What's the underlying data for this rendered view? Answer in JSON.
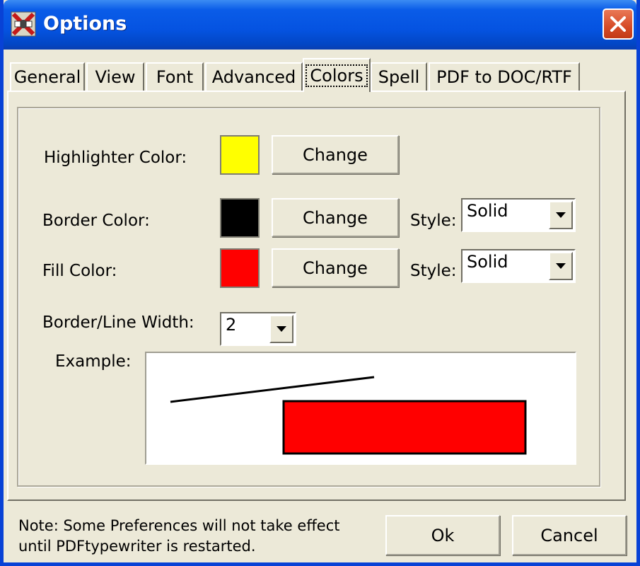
{
  "window": {
    "title": "Options"
  },
  "tabs": [
    {
      "label": "General",
      "active": false
    },
    {
      "label": "View",
      "active": false
    },
    {
      "label": "Font",
      "active": false
    },
    {
      "label": "Advanced",
      "active": false
    },
    {
      "label": "Colors",
      "active": true
    },
    {
      "label": "Spell",
      "active": false
    },
    {
      "label": "PDF to DOC/RTF",
      "active": false
    }
  ],
  "colors": {
    "highlighter": {
      "label": "Highlighter Color:",
      "color": "#ffff00",
      "button": "Change"
    },
    "border": {
      "label": "Border Color:",
      "color": "#000000",
      "button": "Change",
      "style_label": "Style:",
      "style_value": "Solid"
    },
    "fill": {
      "label": "Fill Color:",
      "color": "#ff0000",
      "button": "Change",
      "style_label": "Style:",
      "style_value": "Solid"
    },
    "line_width": {
      "label": "Border/Line Width:",
      "value": "2"
    },
    "example": {
      "label": "Example:"
    }
  },
  "footer": {
    "note_line1": "Note: Some Preferences will not take effect",
    "note_line2": "until PDFtypewriter is restarted.",
    "ok": "Ok",
    "cancel": "Cancel"
  }
}
